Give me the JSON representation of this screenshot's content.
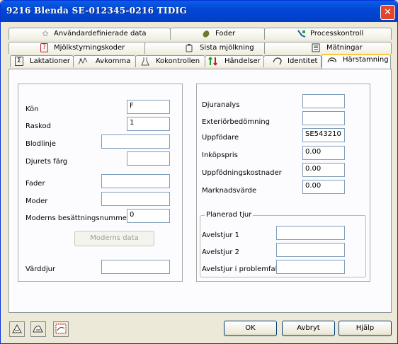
{
  "window": {
    "title": "9216 Blenda  SE-012345-0216  TIDIG",
    "close_glyph": "✕"
  },
  "tabs": {
    "row1": [
      {
        "label": "Användardefinierade data",
        "icon": "flower-icon"
      },
      {
        "label": "Foder",
        "icon": "feed-bag-icon"
      },
      {
        "label": "Processkontroll",
        "icon": "process-chart-icon"
      }
    ],
    "row2": [
      {
        "label": "Mjölkstyrningskoder",
        "icon": "question-icon"
      },
      {
        "label": "Sista mjölkning",
        "icon": "milk-can-icon"
      },
      {
        "label": "Mätningar",
        "icon": "list-icon"
      }
    ],
    "row3": [
      {
        "label": "Laktationer",
        "icon": "sum-icon"
      },
      {
        "label": "Avkomma",
        "icon": "offspring-icon"
      },
      {
        "label": "Kokontrollen",
        "icon": "flask-icon"
      },
      {
        "label": "Händelser",
        "icon": "events-icon"
      },
      {
        "label": "Identitet",
        "icon": "identity-icon"
      },
      {
        "label": "Härstamning",
        "icon": "pedigree-icon",
        "active": true
      }
    ]
  },
  "left": {
    "kon": {
      "label": "Kön",
      "value": "F"
    },
    "raskod": {
      "label": "Raskod",
      "value": "1"
    },
    "blodlinje": {
      "label": "Blodlinje",
      "value": ""
    },
    "farg": {
      "label": "Djurets färg",
      "value": ""
    },
    "fader": {
      "label": "Fader",
      "value": ""
    },
    "moder": {
      "label": "Moder",
      "value": ""
    },
    "besattning": {
      "label": "Moderns besättningsnummer",
      "value": "0"
    },
    "moderns_data_button": "Moderns data",
    "varddjur": {
      "label": "Värddjur",
      "value": ""
    }
  },
  "right": {
    "djuranalys": {
      "label": "Djuranalys",
      "value": ""
    },
    "exterior": {
      "label": "Exteriörbedömning",
      "value": ""
    },
    "uppfodare": {
      "label": "Uppfödare",
      "value": "SE543210"
    },
    "inkopspris": {
      "label": "Inköpspris",
      "value": "0.00"
    },
    "uppfodningskostnader": {
      "label": "Uppfödningskostnader",
      "value": "0.00"
    },
    "marknadsvarde": {
      "label": "Marknadsvärde",
      "value": "0.00"
    }
  },
  "planerad_tjur": {
    "title": "Planerad tjur",
    "avelstjur1": {
      "label": "Avelstjur 1",
      "value": ""
    },
    "avelstjur2": {
      "label": "Avelstjur 2",
      "value": ""
    },
    "problemfall": {
      "label": "Avelstjur i problemfall",
      "value": ""
    }
  },
  "footer": {
    "ok": "OK",
    "cancel": "Avbryt",
    "help": "Hjälp"
  }
}
